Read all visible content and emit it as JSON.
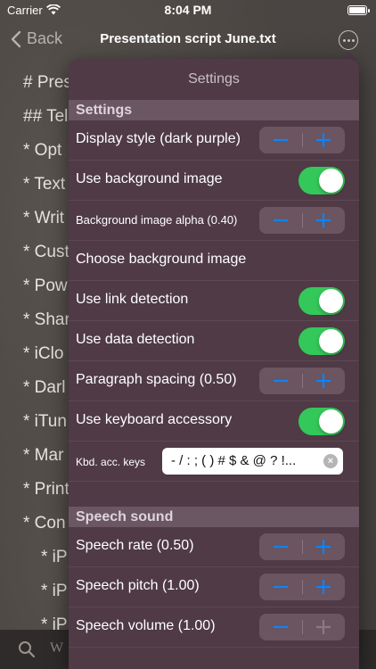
{
  "status": {
    "carrier": "Carrier",
    "time": "8:04 PM"
  },
  "nav": {
    "back_label": "Back",
    "title": "Presentation script June.txt"
  },
  "document": {
    "lines": [
      "# Pres",
      "## Tel",
      "* Opt",
      "* Text",
      "* Writ",
      "* Cust",
      "* Pow",
      "* Shar",
      "* iClo",
      "* Darl",
      "* iTun",
      "* Mar",
      "* Print",
      "* Con",
      "* iP",
      "* iP",
      "* iP"
    ]
  },
  "bottom": {
    "search_text": "W"
  },
  "settings": {
    "title": "Settings",
    "section_general": "Settings",
    "display_style": "Display style (dark purple)",
    "use_bg_image": "Use background image",
    "bg_alpha": "Background image alpha (0.40)",
    "choose_bg": "Choose background image",
    "link_detection": "Use link detection",
    "data_detection": "Use data detection",
    "paragraph_spacing": "Paragraph spacing (0.50)",
    "keyboard_accessory": "Use keyboard accessory",
    "kbd_keys_label": "Kbd. acc. keys",
    "kbd_keys_value": "- / : ; ( ) # $ & @ ? !...",
    "section_speech": "Speech sound",
    "speech_rate": "Speech rate (0.50)",
    "speech_pitch": "Speech pitch (1.00)",
    "speech_volume": "Speech volume (1.00)"
  },
  "toggles": {
    "use_bg_image": true,
    "link_detection": true,
    "data_detection": true,
    "keyboard_accessory": true
  },
  "colors": {
    "accent": "#0a84ff",
    "toggle_on": "#34c759",
    "popover_bg": "#4f3a46",
    "section_bg": "#6b5663"
  }
}
